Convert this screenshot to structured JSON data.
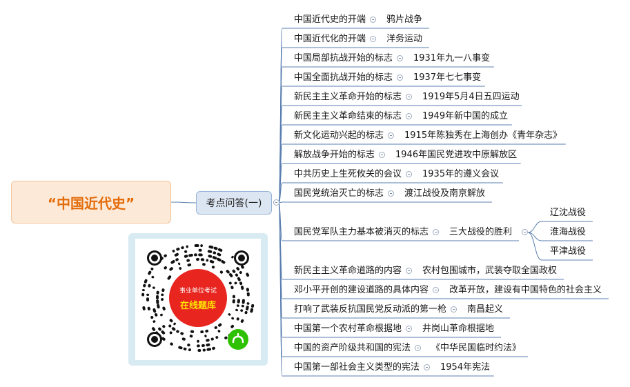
{
  "root": {
    "label": "“中国近代史”"
  },
  "branch": {
    "label": "考点问答(一)"
  },
  "items": [
    {
      "q": "中国近代史的开端",
      "a": "鸦片战争"
    },
    {
      "q": "中国近代化的开端",
      "a": "洋务运动"
    },
    {
      "q": "中国局部抗战开始的标志",
      "a": "1931年九一八事变"
    },
    {
      "q": "中国全面抗战开始的标志",
      "a": "1937年七七事变"
    },
    {
      "q": "新民主主义革命开始的标志",
      "a": "1919年5月4日五四运动"
    },
    {
      "q": "新民主主义革命结束的标志",
      "a": "1949年新中国的成立"
    },
    {
      "q": "新文化运动兴起的标志",
      "a": "1915年陈独秀在上海创办《青年杂志》"
    },
    {
      "q": "解放战争开始的标志",
      "a": "1946年国民党进攻中原解放区"
    },
    {
      "q": "中共历史上生死攸关的会议",
      "a": "1935年的遵义会议"
    },
    {
      "q": "国民党统治灭亡的标志",
      "a": "渡江战役及南京解放"
    },
    {
      "q": "国民党军队主力基本被消灭的标志",
      "a": "三大战役的胜利",
      "sub": [
        "辽沈战役",
        "淮海战役",
        "平津战役"
      ]
    },
    {
      "q": "新民主主义革命道路的内容",
      "a": "农村包围城市，武装夺取全国政权"
    },
    {
      "q": "邓小平开创的建设道路的具体内容",
      "a": "改革开放，建设有中国特色的社会主义"
    },
    {
      "q": "打响了武装反抗国民党反动派的第一枪",
      "a": "南昌起义"
    },
    {
      "q": "中国第一个农村革命根据地",
      "a": "井岗山革命根据地"
    },
    {
      "q": "中国的资产阶级共和国的宪法",
      "a": "《中华民国临时约法》"
    },
    {
      "q": "中国第一部社会主义类型的宪法",
      "a": "1954年宪法"
    }
  ],
  "qr": {
    "line1": "事业单位考试",
    "line2": "在线题库",
    "badge_icon": "mini-program-icon",
    "accent": "#e8251f",
    "text_yellow": "#ffe600",
    "badge_green": "#2dc100"
  },
  "colors": {
    "line": "#5b7fb0",
    "root_text": "#e36c0a"
  }
}
